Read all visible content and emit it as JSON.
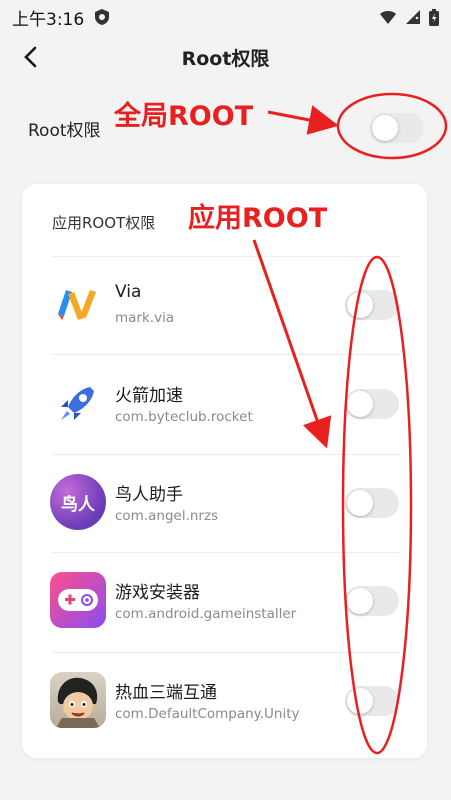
{
  "status": {
    "time": "上午3:16"
  },
  "header": {
    "title": "Root权限"
  },
  "global": {
    "label": "Root权限",
    "enabled": false
  },
  "apps_section": {
    "title": "应用ROOT权限",
    "items": [
      {
        "name": "Via",
        "package": "mark.via",
        "icon": "via-icon",
        "enabled": false
      },
      {
        "name": "火箭加速",
        "package": "com.byteclub.rocket",
        "icon": "rocket-icon",
        "enabled": false
      },
      {
        "name": "鸟人助手",
        "package": "com.angel.nrzs",
        "icon": "niaoren-icon",
        "icon_text": "鸟人",
        "enabled": false
      },
      {
        "name": "游戏安装器",
        "package": "com.android.gameinstaller",
        "icon": "gamepad-icon",
        "enabled": false
      },
      {
        "name": "热血三端互通",
        "package": "com.DefaultCompany.Unity",
        "icon": "cartoon-avatar-icon",
        "enabled": false
      }
    ]
  },
  "annotations": {
    "global": "全局ROOT",
    "apps": "应用ROOT"
  },
  "colors": {
    "annotation": "#e8201f",
    "toggle_off": "#e9e9e9",
    "background": "#f3f3f3"
  }
}
